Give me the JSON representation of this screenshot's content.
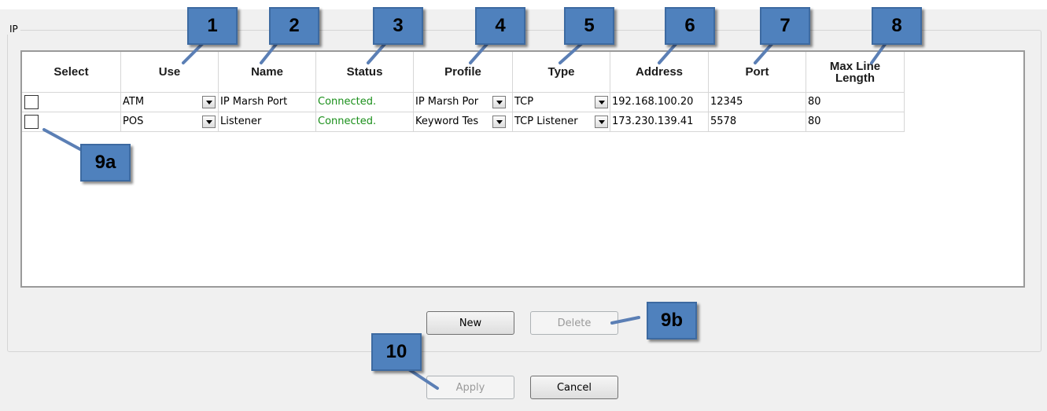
{
  "group_title": "IP",
  "columns": [
    "Select",
    "Use",
    "Name",
    "Status",
    "Profile",
    "Type",
    "Address",
    "Port",
    "Max Line Length"
  ],
  "rows": [
    {
      "selected": false,
      "use": "ATM",
      "name": "IP Marsh Port",
      "status": "Connected.",
      "profile": "IP Marsh Por",
      "type": "TCP",
      "address": "192.168.100.20",
      "port": "12345",
      "max_line_length": "80"
    },
    {
      "selected": false,
      "use": "POS",
      "name": "Listener",
      "status": "Connected.",
      "profile": "Keyword Tes",
      "type": "TCP Listener",
      "address": "173.230.139.41",
      "port": "5578",
      "max_line_length": "80"
    }
  ],
  "buttons": {
    "new": "New",
    "delete": "Delete",
    "apply": "Apply",
    "cancel": "Cancel"
  },
  "callouts": [
    "1",
    "2",
    "3",
    "4",
    "5",
    "6",
    "7",
    "8",
    "9a",
    "9b",
    "10"
  ],
  "colors": {
    "callout_fill": "#4f81bd",
    "status_connected": "#1a8f1a"
  }
}
